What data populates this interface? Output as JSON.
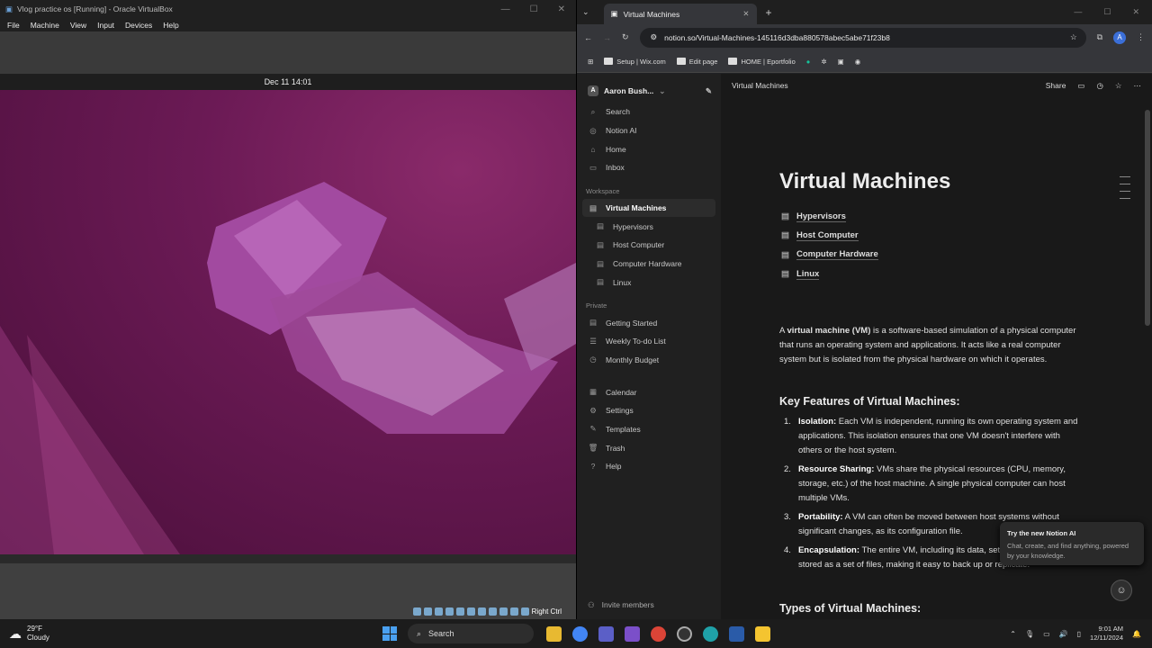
{
  "vbox": {
    "title": "Vlog practice os [Running] - Oracle VirtualBox",
    "menu": [
      "File",
      "Machine",
      "View",
      "Input",
      "Devices",
      "Help"
    ],
    "datetime": "Dec 11  14:01",
    "host_key": "Right Ctrl"
  },
  "browser": {
    "tab_title": "Virtual Machines",
    "url": "notion.so/Virtual-Machines-145116d3dba880578abec5abe71f23b8",
    "bookmarks": [
      "Setup | Wix.com",
      "Edit page",
      "HOME | Eportfolio"
    ]
  },
  "notion": {
    "workspace": "Aaron Bush...",
    "nav": [
      {
        "label": "Search",
        "icon": "⌕"
      },
      {
        "label": "Notion AI",
        "icon": "◎"
      },
      {
        "label": "Home",
        "icon": "⌂"
      },
      {
        "label": "Inbox",
        "icon": "▭"
      }
    ],
    "workspace_heading": "Workspace",
    "workspace_pages": [
      "Virtual Machines",
      "Hypervisors",
      "Host Computer",
      "Computer Hardware",
      "Linux"
    ],
    "private_heading": "Private",
    "private_pages": [
      {
        "label": "Getting Started",
        "icon": "▤"
      },
      {
        "label": "Weekly To-do List",
        "icon": "☰"
      },
      {
        "label": "Monthly Budget",
        "icon": "◷"
      }
    ],
    "tools": [
      {
        "label": "Calendar",
        "icon": "▦"
      },
      {
        "label": "Settings",
        "icon": "⚙"
      },
      {
        "label": "Templates",
        "icon": "✎"
      },
      {
        "label": "Trash",
        "icon": "🗑"
      },
      {
        "label": "Help",
        "icon": "?"
      }
    ],
    "invite": "Invite members",
    "breadcrumb": "Virtual Machines",
    "share": "Share",
    "page_title": "Virtual Machines",
    "subpages": [
      "Hypervisors",
      "Host Computer",
      "Computer Hardware",
      "Linux"
    ],
    "intro_pre": "A ",
    "intro_bold": "virtual machine (VM)",
    "intro_post": " is a software-based simulation of a physical computer that runs an operating system and applications. It acts like a real computer system but is isolated from the physical hardware on which it operates.",
    "features_heading": "Key Features of Virtual Machines:",
    "features": [
      {
        "num": "1.",
        "title": "Isolation:",
        "text": " Each VM is independent, running its own operating system and applications. This isolation ensures that one VM doesn't interfere with others or the host system."
      },
      {
        "num": "2.",
        "title": "Resource Sharing:",
        "text": " VMs share the physical resources (CPU, memory, storage, etc.) of the host machine. A single physical computer can host multiple VMs."
      },
      {
        "num": "3.",
        "title": "Portability:",
        "text": " A VM can often be moved between host systems without significant changes, as its configuration file."
      },
      {
        "num": "4.",
        "title": "Encapsulation:",
        "text": " The entire VM, including its data, settings, and state, is stored as a set of files, making it easy to back up or replicate."
      }
    ],
    "types_heading": "Types of Virtual Machines:",
    "toast_title": "Try the new Notion AI",
    "toast_text": "Chat, create, and find anything, powered by your knowledge."
  },
  "taskbar": {
    "temp": "29°F",
    "weather": "Cloudy",
    "search": "Search",
    "time": "9:01 AM",
    "date": "12/11/2024"
  }
}
